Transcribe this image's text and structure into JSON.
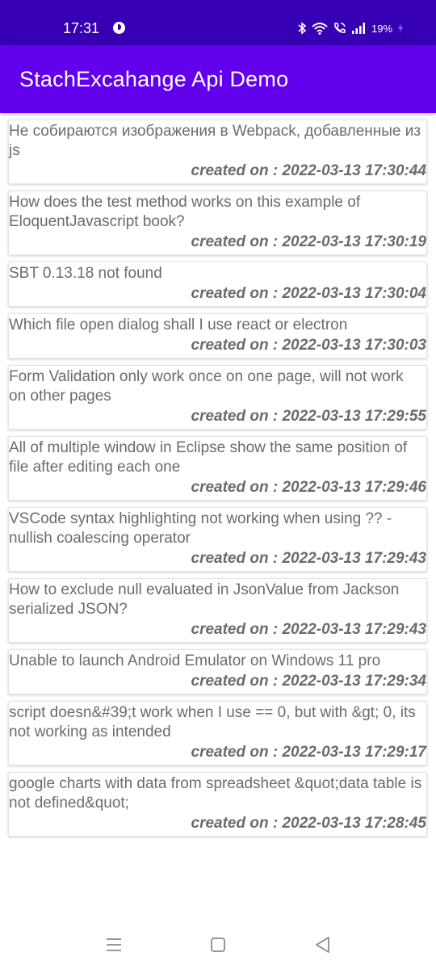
{
  "status_bar": {
    "time": "17:31",
    "battery": "19%",
    "icons": [
      "app-notification-icon",
      "bluetooth-icon",
      "wifi-icon",
      "wifi-calling-icon",
      "signal-icon",
      "battery-charging-icon"
    ]
  },
  "app_bar": {
    "title": "StachExcahange Api Demo",
    "color": "#6200ee",
    "status_color": "#3700b3"
  },
  "questions": [
    {
      "title": "Не собираются изображения в Webpack, добавленные из js",
      "date": "created on : 2022-03-13 17:30:44"
    },
    {
      "title": "How does the test method works on this example of EloquentJavascript book?",
      "date": "created on : 2022-03-13 17:30:19"
    },
    {
      "title": "SBT 0.13.18 not found",
      "date": "created on : 2022-03-13 17:30:04"
    },
    {
      "title": "Which file open dialog shall I use react or electron",
      "date": "created on : 2022-03-13 17:30:03"
    },
    {
      "title": "Form Validation only work once on one page, will not work on other pages",
      "date": "created on : 2022-03-13 17:29:55"
    },
    {
      "title": "All of multiple window in Eclipse show the same position of file after editing each one",
      "date": "created on : 2022-03-13 17:29:46"
    },
    {
      "title": "VSCode syntax highlighting not working when using ?? - nullish coalescing operator",
      "date": "created on : 2022-03-13 17:29:43"
    },
    {
      "title": "How to exclude null evaluated in JsonValue from Jackson serialized JSON?",
      "date": "created on : 2022-03-13 17:29:43"
    },
    {
      "title": "Unable to launch Android Emulator on Windows 11 pro",
      "date": "created on : 2022-03-13 17:29:34"
    },
    {
      "title": "script doesn&#39;t work when I use == 0, but with &gt; 0, its not working as intended",
      "date": "created on : 2022-03-13 17:29:17"
    },
    {
      "title": "google charts with data from spreadsheet &quot;data table is not defined&quot;",
      "date": "created on : 2022-03-13 17:28:45"
    }
  ],
  "nav_bar": {
    "icons": [
      "recent-apps-icon",
      "home-icon",
      "back-icon"
    ]
  }
}
